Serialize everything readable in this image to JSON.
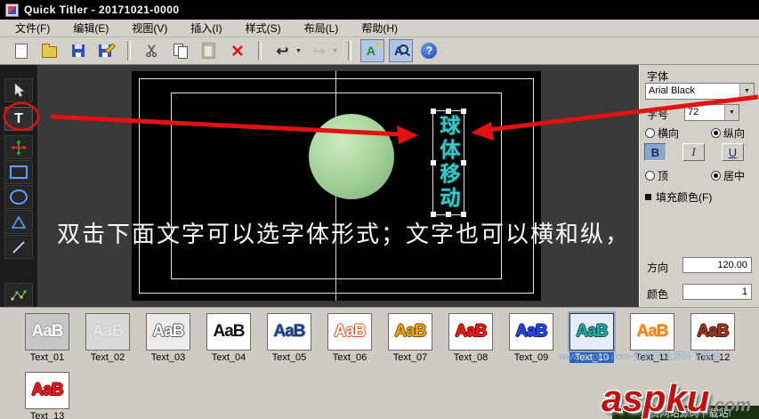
{
  "window": {
    "title": "Quick Titler - 20171021-0000"
  },
  "menubar": {
    "items": [
      {
        "label": "文件(F)"
      },
      {
        "label": "编辑(E)"
      },
      {
        "label": "视图(V)"
      },
      {
        "label": "插入(I)"
      },
      {
        "label": "样式(S)"
      },
      {
        "label": "布局(L)"
      },
      {
        "label": "帮助(H)"
      }
    ]
  },
  "toolbar": {
    "buttons": [
      {
        "name": "new-document",
        "icon": "page"
      },
      {
        "name": "open-file",
        "icon": "folder"
      },
      {
        "name": "save",
        "icon": "floppy"
      },
      {
        "name": "save-as",
        "icon": "floppy-pencil"
      },
      {
        "sep": true
      },
      {
        "name": "cut",
        "icon": "scissors"
      },
      {
        "name": "copy",
        "icon": "copy"
      },
      {
        "name": "paste",
        "icon": "clipboard",
        "disabled": true
      },
      {
        "name": "delete",
        "icon": "red-x"
      },
      {
        "sep": true
      },
      {
        "name": "undo",
        "icon": "undo-arrow",
        "dropdown": true
      },
      {
        "name": "redo",
        "icon": "redo-arrow",
        "dropdown": true,
        "disabled": true
      },
      {
        "sep": true
      },
      {
        "name": "style-library",
        "icon": "a-star"
      },
      {
        "name": "zoom-text",
        "icon": "a-magnifier"
      },
      {
        "name": "help",
        "icon": "question"
      }
    ]
  },
  "tools": {
    "items": [
      {
        "name": "select-tool",
        "icon": "cursor"
      },
      {
        "name": "text-tool",
        "icon": "text",
        "active": true
      },
      {
        "name": "transform-tool",
        "icon": "move-cross"
      },
      {
        "name": "rectangle-tool",
        "icon": "rect"
      },
      {
        "name": "ellipse-tool",
        "icon": "ellipse"
      },
      {
        "name": "triangle-tool",
        "icon": "triangle"
      },
      {
        "name": "line-tool",
        "icon": "line"
      },
      {
        "name": "edit-points-tool",
        "icon": "nodes"
      }
    ]
  },
  "canvas": {
    "vertical_text": "球体移动",
    "vertical_text_color": "#3fc6c6",
    "typed_text": "双击下面文字可以选字体形式；文字也可以横和纵，"
  },
  "properties": {
    "font_label": "字体",
    "font_value": "Arial Black",
    "size_label": "字号",
    "size_value": "72",
    "orient_h": "横向",
    "orient_v": "纵向",
    "bold_label": "B",
    "italic_label": "I",
    "underline_label": "U",
    "align_top": "顶",
    "align_center": "居中",
    "fill_label": "填充颜色(F)",
    "direction_label": "方向",
    "direction_value": "120.00",
    "color_label": "颜色",
    "color_value": "1"
  },
  "styles": {
    "preview_text": "AaB",
    "items": [
      {
        "label": "Text_01",
        "fg": "#ffffff",
        "outline": "#9a9a9a",
        "bg": "#c6c6c6"
      },
      {
        "label": "Text_02",
        "fg": "#e4e4e4",
        "outline": "#c8c8c8",
        "bg": "#d9d9d9"
      },
      {
        "label": "Text_03",
        "fg": "#ffffff",
        "outline": "#555555",
        "bg": "#ececec"
      },
      {
        "label": "Text_04",
        "fg": "#111111",
        "outline": "none",
        "bg": "#ffffff"
      },
      {
        "label": "Text_05",
        "fg": "#1e3a6e",
        "outline": "#9db8e8",
        "bg": "#ffffff"
      },
      {
        "label": "Text_06",
        "fg": "#ffffff",
        "outline": "#e04818",
        "bg": "#ffffff"
      },
      {
        "label": "Text_07",
        "fg": "#f6a11a",
        "outline": "#6a4a00",
        "bg": "#ffffff"
      },
      {
        "label": "Text_08",
        "fg": "#e02020",
        "outline": "#8a0000",
        "bg": "#ffffff"
      },
      {
        "label": "Text_09",
        "fg": "#2a46e8",
        "outline": "#101a66",
        "bg": "#ffffff"
      },
      {
        "label": "Text_10",
        "fg": "#28a8a8",
        "outline": "#0c4a4a",
        "bg": "#e6edf8",
        "selected": true
      },
      {
        "label": "Text_11",
        "fg": "#f08020",
        "outline": "#ffe0b0",
        "bg": "#ffffff"
      },
      {
        "label": "Text_12",
        "fg": "#9a3a20",
        "outline": "#4a1000",
        "bg": "#ffffff"
      }
    ],
    "row2": [
      {
        "label": "Text_13",
        "fg": "#e02020",
        "outline": "#8a0000",
        "bg": "#ffffff"
      }
    ]
  },
  "watermark": {
    "brand": "aspku",
    "brand_suffix": ".com",
    "tagline": "免费网站源码下载站!",
    "faint_text": "www.aspku.com-免费网站源码下载站!"
  },
  "annotations": {
    "color": "#e01212"
  }
}
